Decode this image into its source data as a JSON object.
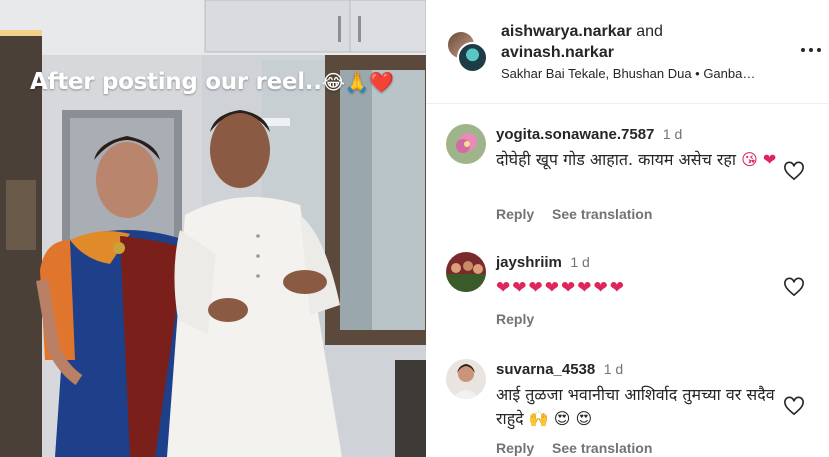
{
  "media": {
    "caption": "After posting our reel..",
    "caption_emojis": [
      "laughing-emoji",
      "folded-hands-emoji",
      "red-heart-emoji"
    ]
  },
  "header": {
    "author_1": "aishwarya.narkar",
    "and_text": "and",
    "author_2": "avinash.narkar",
    "audio_info": "Sakhar Bai Tekale, Bhushan Dua • Ganba…",
    "more_icon": "more-horizontal-icon"
  },
  "comments": [
    {
      "username": "yogita.sonawane.7587",
      "time": "1 d",
      "text": "दोघेही खूप गोड आहात. कायम असेच रहा",
      "text_emojis": "😘 ❤",
      "actions": [
        "Reply",
        "See translation"
      ],
      "like_icon": "heart-outline-icon"
    },
    {
      "username": "jayshriim",
      "time": "1 d",
      "text": "",
      "text_emojis": "❤❤❤❤❤❤❤❤",
      "actions": [
        "Reply"
      ],
      "like_icon": "heart-outline-icon"
    },
    {
      "username": "suvarna_4538",
      "time": "1 d",
      "text": "आई तुळजा भवानीचा आशिर्वाद तुमच्या वर सदैव राहुदे",
      "text_emojis": "🙌 😍 😍",
      "actions": [
        "Reply",
        "See translation"
      ],
      "like_icon": "heart-outline-icon"
    }
  ],
  "colors": {
    "text_primary": "#262626",
    "text_secondary": "#737373",
    "heart_red": "#e0245e"
  }
}
